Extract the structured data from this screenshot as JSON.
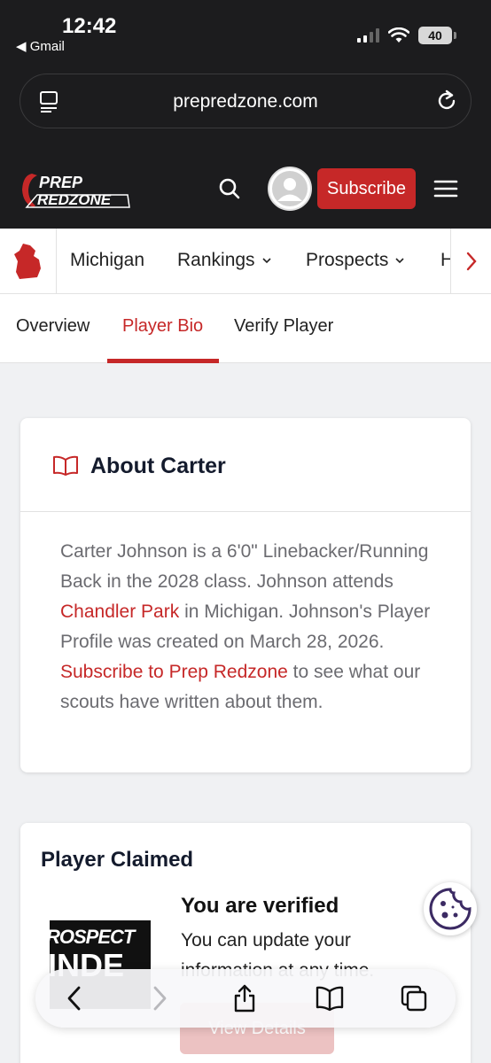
{
  "status": {
    "time": "12:42",
    "back_label": "◀ Gmail",
    "battery": "40"
  },
  "browser": {
    "url": "prepredzone.com"
  },
  "header": {
    "logo_line1": "PREP",
    "logo_line2": "REDZONE",
    "subscribe_label": "Subscribe"
  },
  "nav": {
    "items": [
      {
        "label": "Michigan",
        "has_dropdown": false
      },
      {
        "label": "Rankings",
        "has_dropdown": true
      },
      {
        "label": "Prospects",
        "has_dropdown": true
      },
      {
        "label": "H",
        "has_dropdown": false
      }
    ]
  },
  "tabs": [
    {
      "label": "Overview",
      "active": false
    },
    {
      "label": "Player Bio",
      "active": true
    },
    {
      "label": "Verify Player",
      "active": false
    }
  ],
  "about": {
    "title": "About Carter",
    "text_1": "Carter Johnson is a 6'0\" Linebacker/Running Back in the 2028 class. Johnson attends ",
    "link_school": "Chandler Park",
    "text_2": " in Michigan. Johnson's Player Profile was created on March 28, 2026. ",
    "link_subscribe": "Subscribe to Prep Redzone",
    "text_3": " to see what our scouts have written about them."
  },
  "claimed": {
    "title": "Player Claimed",
    "image_text_1": "ROSPECT",
    "image_text_2": "INDE",
    "verified_title": "You are verified",
    "verified_desc": "You can update your information at any time.",
    "button_label": "View Details"
  },
  "colors": {
    "accent": "#c62828",
    "chrome": "#1c1c1e",
    "cookie": "#3b2a63"
  }
}
